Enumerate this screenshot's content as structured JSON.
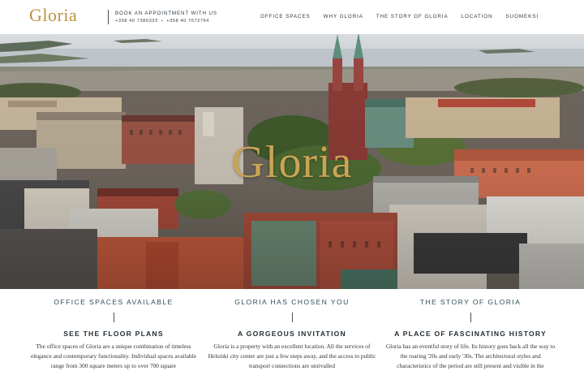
{
  "header": {
    "logo": "Gloria",
    "booking_title": "BOOK AN APPOINTMENT WITH US",
    "phone_1": "+358 40 7386333",
    "phone_separator": "•",
    "phone_2": "+358 40 7672764",
    "nav": [
      {
        "label": "OFFICE SPACES"
      },
      {
        "label": "WHY GLORIA"
      },
      {
        "label": "THE STORY OF GLORIA"
      },
      {
        "label": "LOCATION"
      },
      {
        "label": "SUOMEKSI"
      }
    ]
  },
  "hero": {
    "wordmark": "Gloria"
  },
  "columns": [
    {
      "heading": "OFFICE SPACES AVAILABLE",
      "subheading": "SEE THE FLOOR PLANS",
      "body": "The office spaces of Gloria are a unique combination of timeless elegance and contemporary functionality. Individual spaces available range from 300 square meters up to over 700 square"
    },
    {
      "heading": "GLORIA HAS CHOSEN YOU",
      "subheading": "A GORGEOUS INVITATION",
      "body": "Gloria is a property with an excellent location. All the services of Helsinki city center are just a few steps away, and the access to public transport connections are unrivalled"
    },
    {
      "heading": "THE STORY OF GLORIA",
      "subheading": "A PLACE OF FASCINATING HISTORY",
      "body": "Gloria has an eventful story of life. Its history goes back all the way to the roaring '20s and early '30s. The architectural styles and characteristics of the period are still present and visible in the"
    }
  ],
  "colors": {
    "gold": "#b9933f",
    "heading": "#2f4f5a",
    "text": "#2f3b45"
  }
}
